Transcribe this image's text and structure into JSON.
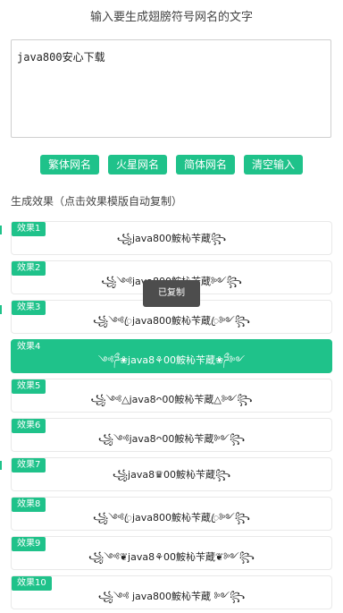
{
  "header": {
    "title": "输入要生成翅膀符号网名的文字"
  },
  "input": {
    "value": "java800安心下载"
  },
  "buttons": [
    {
      "label": "繁体网名"
    },
    {
      "label": "火星网名"
    },
    {
      "label": "简体网名"
    },
    {
      "label": "清空输入"
    }
  ],
  "section": {
    "title": "生成效果（点击效果模版自动复制）"
  },
  "results": [
    {
      "label": "效果1",
      "text": "꧁java800鮟杺苄蔵꧂"
    },
    {
      "label": "效果2",
      "text": "꧁༺java800鮟杺苄蔵༻꧂"
    },
    {
      "label": "效果3",
      "text": "꧁༺ꦿjava800鮟杺苄蔵ꦿ༻꧂"
    },
    {
      "label": "效果4",
      "text": "༺ཌྀ❀java8⚘00鮟杺苄蔵❀ཌྀ༻"
    },
    {
      "label": "效果5",
      "text": "꧁༺△java8ᴖ00鮟杺苄蔵△༻꧂"
    },
    {
      "label": "效果6",
      "text": "꧁༺java8ᴖ00鮟杺苄蔵༻꧂"
    },
    {
      "label": "效果7",
      "text": "꧁java8♛00鮟杺苄蔵꧂"
    },
    {
      "label": "效果8",
      "text": "꧁༺ꦿjava800鮟杺苄蔵ꦿ༻꧂"
    },
    {
      "label": "效果9",
      "text": "꧁༺❦java8⚘00鮟杺苄蔵❦༻꧂"
    },
    {
      "label": "效果10",
      "text": "꧁༺ java800鮟杺苄蔵 ༻꧂"
    }
  ],
  "toast": {
    "text": "已复制"
  },
  "colors": {
    "accent": "#1fc28a"
  }
}
